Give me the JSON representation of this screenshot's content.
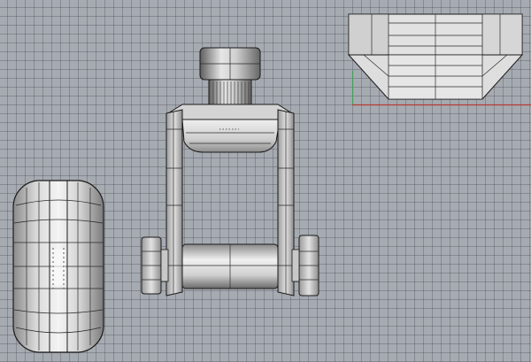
{
  "viewport": {
    "type": "orthographic-cad-view",
    "grid_color": "#5a5e66",
    "background_color": "#a6aab1"
  },
  "colors": {
    "axis_x": "#b63a35",
    "axis_y": "#43a05a",
    "edge": "#1a1a1a"
  },
  "objects": [
    {
      "name": "wheel-side-view",
      "icon": "rounded-tire-shape"
    },
    {
      "name": "caster-assembly-front-view",
      "icon": "fork-with-axle"
    },
    {
      "name": "top-block-view",
      "icon": "trapezoid-block"
    }
  ]
}
